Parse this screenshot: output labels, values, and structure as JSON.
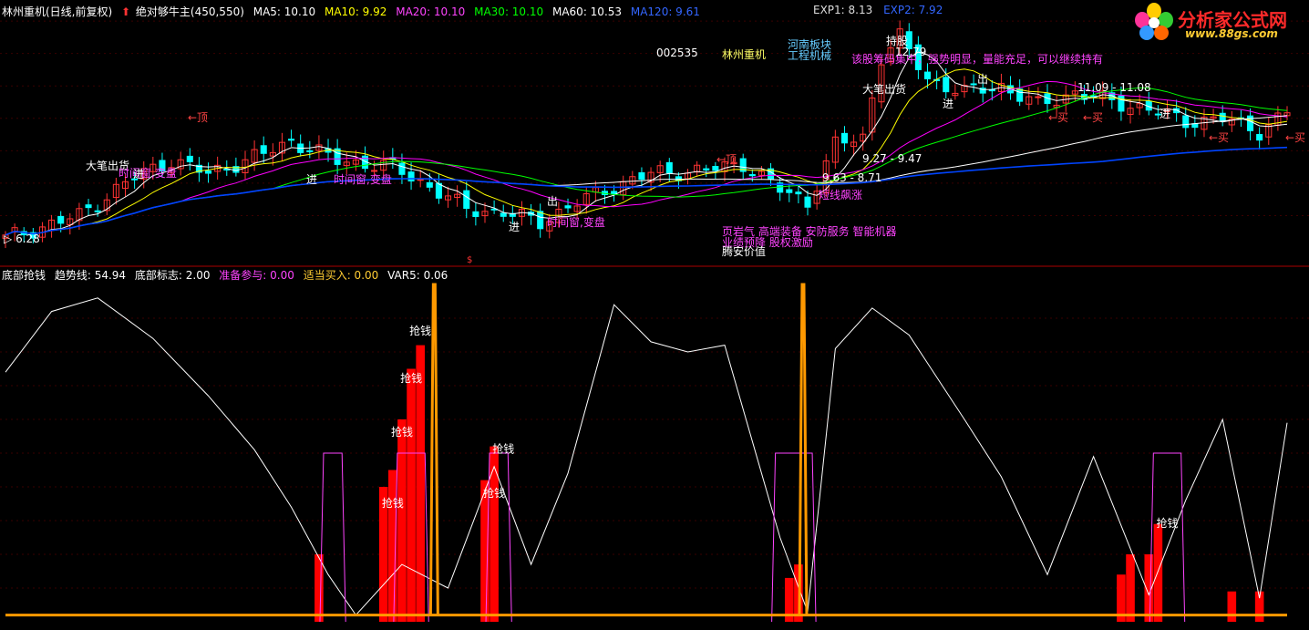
{
  "header": {
    "stock": "林州重机(日线,前复权)",
    "indicator": "绝对够牛主(450,550)",
    "ma5": "MA5: 10.10",
    "ma10": "MA10: 9.92",
    "ma20": "MA20: 10.10",
    "ma30": "MA30: 10.10",
    "ma60": "MA60: 10.53",
    "ma120": "MA120: 9.61",
    "exp1": "EXP1: 8.13",
    "exp2": "EXP2: 7.92"
  },
  "logo": {
    "name": "分析家公式网",
    "url": "www.88gs.com"
  },
  "annotations": {
    "code": "002535",
    "name": "林州重机",
    "region": "河南板块",
    "industry": "工程机械",
    "comment": "该股筹码集中，强势明显，量能充足，可以继续持有",
    "concepts1": "页岩气 高端装备 安防服务 智能机器",
    "concepts2": "业绩预降 股权激励",
    "concepts3": "腾安价值",
    "low_price": "6.28",
    "high_price": "12.79",
    "range1": "11.09 - 11.08",
    "range2": "9.27 - 9.47",
    "range3": "9.63 - 8.71",
    "dollar": "$"
  },
  "chart_labels": {
    "top": "←顶",
    "out": "出",
    "in": "进",
    "buy": "←买",
    "cash_out": "大笔出货",
    "time_window": "时间窗,变盘",
    "short_rise": "短线飙涨",
    "hold": "持股"
  },
  "lower_header": {
    "title": "底部抢钱",
    "trend": "趋势线: 54.94",
    "bottom_flag": "底部标志: 2.00",
    "prepare": "准备参与: 0.00",
    "buy_in": "适当买入: 0.00",
    "var5": "VAR5: 0.06"
  },
  "lower_labels": {
    "grab": "抢钱"
  },
  "colors": {
    "background": "#000000",
    "up": "#ff3333",
    "down": "#00ffff",
    "ma5": "#ffffff",
    "ma10": "#ffff00",
    "ma20": "#ff00ff",
    "ma30": "#00ff00",
    "ma60": "#ffffff",
    "ma120": "#0044ff",
    "trend": "#ffffff",
    "flag": "#ff44ff",
    "bars": "#ff0000",
    "orange": "#ff9900",
    "magenta_text": "#ff44ff"
  },
  "chart_data": [
    {
      "type": "candlestick",
      "title": "林州重机(日线,前复权)",
      "ylim": [
        6.0,
        13.2
      ],
      "n": 140,
      "anchor_closes": [
        [
          0,
          6.3
        ],
        [
          8,
          7.0
        ],
        [
          14,
          8.2
        ],
        [
          18,
          8.7
        ],
        [
          22,
          8.3
        ],
        [
          28,
          8.9
        ],
        [
          31,
          9.3
        ],
        [
          36,
          8.7
        ],
        [
          42,
          8.5
        ],
        [
          46,
          7.9
        ],
        [
          50,
          7.2
        ],
        [
          54,
          7.1
        ],
        [
          58,
          6.8
        ],
        [
          62,
          7.4
        ],
        [
          66,
          7.9
        ],
        [
          70,
          8.3
        ],
        [
          76,
          8.4
        ],
        [
          80,
          8.6
        ],
        [
          84,
          7.8
        ],
        [
          87,
          7.4
        ],
        [
          90,
          9.2
        ],
        [
          93,
          9.4
        ],
        [
          95,
          11.9
        ],
        [
          97,
          12.5
        ],
        [
          100,
          11.2
        ],
        [
          104,
          10.8
        ],
        [
          108,
          11.0
        ],
        [
          112,
          10.4
        ],
        [
          116,
          10.8
        ],
        [
          120,
          10.5
        ],
        [
          124,
          10.3
        ],
        [
          128,
          9.9
        ],
        [
          132,
          10.0
        ],
        [
          136,
          9.6
        ],
        [
          139,
          10.2
        ]
      ],
      "series": [
        {
          "name": "MA5",
          "window": 5
        },
        {
          "name": "MA10",
          "window": 10
        },
        {
          "name": "MA20",
          "window": 20
        },
        {
          "name": "MA30",
          "window": 30
        },
        {
          "name": "MA60",
          "window": 60
        },
        {
          "name": "MA120",
          "window": 120
        }
      ]
    },
    {
      "type": "line",
      "title": "底部抢钱",
      "ylim": [
        0,
        100
      ],
      "trend_points": [
        [
          0,
          74
        ],
        [
          5,
          92
        ],
        [
          10,
          96
        ],
        [
          16,
          84
        ],
        [
          22,
          67
        ],
        [
          27,
          51
        ],
        [
          31,
          34
        ],
        [
          35,
          14
        ],
        [
          38,
          2
        ],
        [
          43,
          17
        ],
        [
          48,
          10
        ],
        [
          53,
          46
        ],
        [
          57,
          17
        ],
        [
          61,
          44
        ],
        [
          66,
          94
        ],
        [
          70,
          83
        ],
        [
          74,
          80
        ],
        [
          78,
          82
        ],
        [
          84,
          25
        ],
        [
          87,
          3
        ],
        [
          90,
          81
        ],
        [
          94,
          93
        ],
        [
          98,
          85
        ],
        [
          104,
          60
        ],
        [
          108,
          43
        ],
        [
          113,
          14
        ],
        [
          118,
          49
        ],
        [
          124,
          8
        ],
        [
          128,
          36
        ],
        [
          132,
          60
        ],
        [
          136,
          7
        ],
        [
          139,
          59
        ]
      ],
      "flag_regions": [
        [
          35,
          36
        ],
        [
          43,
          45
        ],
        [
          53,
          54
        ],
        [
          84,
          87
        ],
        [
          125,
          127
        ]
      ],
      "red_bars": [
        {
          "x": 34,
          "v": 20
        },
        {
          "x": 41,
          "v": 40
        },
        {
          "x": 42,
          "v": 45
        },
        {
          "x": 43,
          "v": 60
        },
        {
          "x": 44,
          "v": 75
        },
        {
          "x": 45,
          "v": 82
        },
        {
          "x": 52,
          "v": 42
        },
        {
          "x": 53,
          "v": 52
        },
        {
          "x": 85,
          "v": 13
        },
        {
          "x": 86,
          "v": 17
        },
        {
          "x": 121,
          "v": 14
        },
        {
          "x": 122,
          "v": 20
        },
        {
          "x": 124,
          "v": 20
        },
        {
          "x": 125,
          "v": 29
        },
        {
          "x": 133,
          "v": 9
        },
        {
          "x": 136,
          "v": 9
        }
      ],
      "grab_labels": [
        {
          "x": 42,
          "v": 33
        },
        {
          "x": 43,
          "v": 54
        },
        {
          "x": 44,
          "v": 70
        },
        {
          "x": 45,
          "v": 84
        },
        {
          "x": 53,
          "v": 36
        },
        {
          "x": 54,
          "v": 49
        },
        {
          "x": 126,
          "v": 27
        }
      ],
      "orange_spikes": [
        46.5,
        86.5
      ],
      "orange_base": 2
    }
  ]
}
